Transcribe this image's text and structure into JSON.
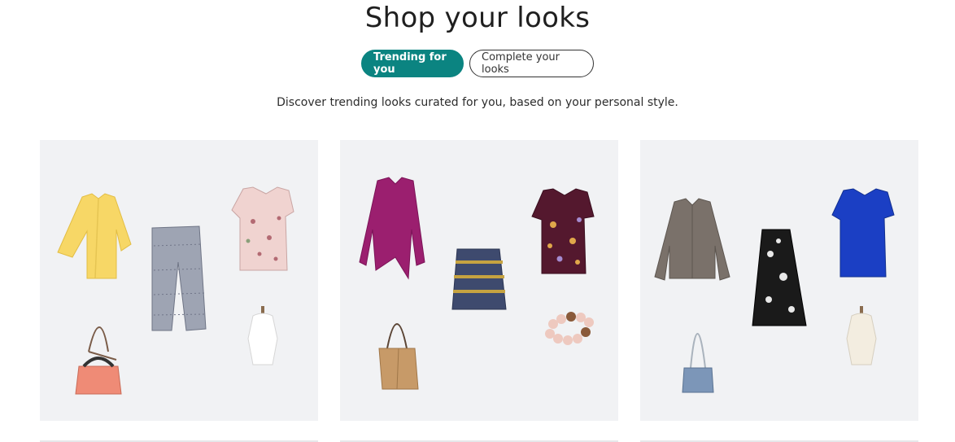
{
  "page": {
    "title": "Shop your looks",
    "subtitle": "Discover trending looks curated for you, based on your personal style."
  },
  "tabs": [
    {
      "label": "Trending for you",
      "active": true
    },
    {
      "label": "Complete your looks",
      "active": false
    }
  ],
  "colors": {
    "accent": "#0b8481",
    "card_background": "#f1f2f4"
  },
  "looks": [
    {
      "items": [
        "yellow-cardigan",
        "patterned-cropped-pants",
        "floral-blouse",
        "coral-tote-bag",
        "bust-form"
      ]
    },
    {
      "items": [
        "magenta-wrap-cardigan",
        "printed-mini-skirt",
        "floral-cap-sleeve-top",
        "tan-bucket-bag",
        "beaded-bracelet"
      ]
    },
    {
      "items": [
        "gray-suede-jacket",
        "floral-midi-skirt",
        "cobalt-blouse",
        "denim-crossbody-bag",
        "bust-form"
      ]
    }
  ]
}
